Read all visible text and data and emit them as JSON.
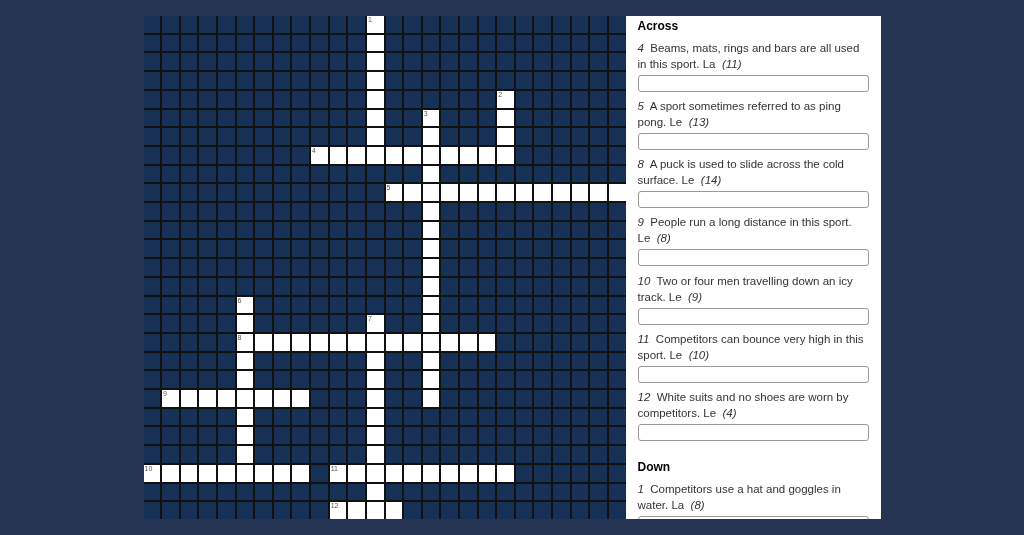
{
  "grid": {
    "rows": [
      [
        {
          "open": false
        },
        {
          "open": false
        },
        {
          "open": false
        },
        {
          "open": false
        },
        {
          "open": false
        },
        {
          "open": false
        },
        {
          "open": false
        },
        {
          "open": false
        },
        {
          "open": false
        },
        {
          "open": false
        },
        {
          "open": false
        },
        {
          "open": false
        },
        {
          "open": true,
          "number": "1"
        },
        {
          "open": false
        },
        {
          "open": false
        },
        {
          "open": false
        },
        {
          "open": false
        },
        {
          "open": false
        },
        {
          "open": false
        },
        {
          "open": false
        },
        {
          "open": false
        },
        {
          "open": false
        },
        {
          "open": false
        },
        {
          "open": false
        },
        {
          "open": false
        },
        {
          "open": false
        }
      ],
      [
        {
          "open": false
        },
        {
          "open": false
        },
        {
          "open": false
        },
        {
          "open": false
        },
        {
          "open": false
        },
        {
          "open": false
        },
        {
          "open": false
        },
        {
          "open": false
        },
        {
          "open": false
        },
        {
          "open": false
        },
        {
          "open": false
        },
        {
          "open": false
        },
        {
          "open": true
        },
        {
          "open": false
        },
        {
          "open": false
        },
        {
          "open": false
        },
        {
          "open": false
        },
        {
          "open": false
        },
        {
          "open": false
        },
        {
          "open": false
        },
        {
          "open": false
        },
        {
          "open": false
        },
        {
          "open": false
        },
        {
          "open": false
        },
        {
          "open": false
        },
        {
          "open": false
        }
      ],
      [
        {
          "open": false
        },
        {
          "open": false
        },
        {
          "open": false
        },
        {
          "open": false
        },
        {
          "open": false
        },
        {
          "open": false
        },
        {
          "open": false
        },
        {
          "open": false
        },
        {
          "open": false
        },
        {
          "open": false
        },
        {
          "open": false
        },
        {
          "open": false
        },
        {
          "open": true
        },
        {
          "open": false
        },
        {
          "open": false
        },
        {
          "open": false
        },
        {
          "open": false
        },
        {
          "open": false
        },
        {
          "open": false
        },
        {
          "open": false
        },
        {
          "open": false
        },
        {
          "open": false
        },
        {
          "open": false
        },
        {
          "open": false
        },
        {
          "open": false
        },
        {
          "open": false
        }
      ],
      [
        {
          "open": false
        },
        {
          "open": false
        },
        {
          "open": false
        },
        {
          "open": false
        },
        {
          "open": false
        },
        {
          "open": false
        },
        {
          "open": false
        },
        {
          "open": false
        },
        {
          "open": false
        },
        {
          "open": false
        },
        {
          "open": false
        },
        {
          "open": false
        },
        {
          "open": true
        },
        {
          "open": false
        },
        {
          "open": false
        },
        {
          "open": false
        },
        {
          "open": false
        },
        {
          "open": false
        },
        {
          "open": false
        },
        {
          "open": false
        },
        {
          "open": false
        },
        {
          "open": false
        },
        {
          "open": false
        },
        {
          "open": false
        },
        {
          "open": false
        },
        {
          "open": false
        }
      ],
      [
        {
          "open": false
        },
        {
          "open": false
        },
        {
          "open": false
        },
        {
          "open": false
        },
        {
          "open": false
        },
        {
          "open": false
        },
        {
          "open": false
        },
        {
          "open": false
        },
        {
          "open": false
        },
        {
          "open": false
        },
        {
          "open": false
        },
        {
          "open": false
        },
        {
          "open": true
        },
        {
          "open": false
        },
        {
          "open": false
        },
        {
          "open": false
        },
        {
          "open": false
        },
        {
          "open": false
        },
        {
          "open": false
        },
        {
          "open": true,
          "number": "2"
        },
        {
          "open": false
        },
        {
          "open": false
        },
        {
          "open": false
        },
        {
          "open": false
        },
        {
          "open": false
        },
        {
          "open": false
        }
      ],
      [
        {
          "open": false
        },
        {
          "open": false
        },
        {
          "open": false
        },
        {
          "open": false
        },
        {
          "open": false
        },
        {
          "open": false
        },
        {
          "open": false
        },
        {
          "open": false
        },
        {
          "open": false
        },
        {
          "open": false
        },
        {
          "open": false
        },
        {
          "open": false
        },
        {
          "open": true
        },
        {
          "open": false
        },
        {
          "open": false
        },
        {
          "open": true,
          "number": "3"
        },
        {
          "open": false
        },
        {
          "open": false
        },
        {
          "open": false
        },
        {
          "open": true
        },
        {
          "open": false
        },
        {
          "open": false
        },
        {
          "open": false
        },
        {
          "open": false
        },
        {
          "open": false
        },
        {
          "open": false
        }
      ],
      [
        {
          "open": false
        },
        {
          "open": false
        },
        {
          "open": false
        },
        {
          "open": false
        },
        {
          "open": false
        },
        {
          "open": false
        },
        {
          "open": false
        },
        {
          "open": false
        },
        {
          "open": false
        },
        {
          "open": false
        },
        {
          "open": false
        },
        {
          "open": false
        },
        {
          "open": true
        },
        {
          "open": false
        },
        {
          "open": false
        },
        {
          "open": true
        },
        {
          "open": false
        },
        {
          "open": false
        },
        {
          "open": false
        },
        {
          "open": true
        },
        {
          "open": false
        },
        {
          "open": false
        },
        {
          "open": false
        },
        {
          "open": false
        },
        {
          "open": false
        },
        {
          "open": false
        }
      ],
      [
        {
          "open": false
        },
        {
          "open": false
        },
        {
          "open": false
        },
        {
          "open": false
        },
        {
          "open": false
        },
        {
          "open": false
        },
        {
          "open": false
        },
        {
          "open": false
        },
        {
          "open": false
        },
        {
          "open": true,
          "number": "4"
        },
        {
          "open": true
        },
        {
          "open": true
        },
        {
          "open": true
        },
        {
          "open": true
        },
        {
          "open": true
        },
        {
          "open": true
        },
        {
          "open": true
        },
        {
          "open": true
        },
        {
          "open": true
        },
        {
          "open": true
        },
        {
          "open": false
        },
        {
          "open": false
        },
        {
          "open": false
        },
        {
          "open": false
        },
        {
          "open": false
        },
        {
          "open": false
        }
      ],
      [
        {
          "open": false
        },
        {
          "open": false
        },
        {
          "open": false
        },
        {
          "open": false
        },
        {
          "open": false
        },
        {
          "open": false
        },
        {
          "open": false
        },
        {
          "open": false
        },
        {
          "open": false
        },
        {
          "open": false
        },
        {
          "open": false
        },
        {
          "open": false
        },
        {
          "open": false
        },
        {
          "open": false
        },
        {
          "open": false
        },
        {
          "open": true
        },
        {
          "open": false
        },
        {
          "open": false
        },
        {
          "open": false
        },
        {
          "open": false
        },
        {
          "open": false
        },
        {
          "open": false
        },
        {
          "open": false
        },
        {
          "open": false
        },
        {
          "open": false
        },
        {
          "open": false
        }
      ],
      [
        {
          "open": false
        },
        {
          "open": false
        },
        {
          "open": false
        },
        {
          "open": false
        },
        {
          "open": false
        },
        {
          "open": false
        },
        {
          "open": false
        },
        {
          "open": false
        },
        {
          "open": false
        },
        {
          "open": false
        },
        {
          "open": false
        },
        {
          "open": false
        },
        {
          "open": false
        },
        {
          "open": true,
          "number": "5"
        },
        {
          "open": true
        },
        {
          "open": true
        },
        {
          "open": true
        },
        {
          "open": true
        },
        {
          "open": true
        },
        {
          "open": true
        },
        {
          "open": true
        },
        {
          "open": true
        },
        {
          "open": true
        },
        {
          "open": true
        },
        {
          "open": true
        },
        {
          "open": true
        }
      ],
      [
        {
          "open": false
        },
        {
          "open": false
        },
        {
          "open": false
        },
        {
          "open": false
        },
        {
          "open": false
        },
        {
          "open": false
        },
        {
          "open": false
        },
        {
          "open": false
        },
        {
          "open": false
        },
        {
          "open": false
        },
        {
          "open": false
        },
        {
          "open": false
        },
        {
          "open": false
        },
        {
          "open": false
        },
        {
          "open": false
        },
        {
          "open": true
        },
        {
          "open": false
        },
        {
          "open": false
        },
        {
          "open": false
        },
        {
          "open": false
        },
        {
          "open": false
        },
        {
          "open": false
        },
        {
          "open": false
        },
        {
          "open": false
        },
        {
          "open": false
        },
        {
          "open": false
        }
      ],
      [
        {
          "open": false
        },
        {
          "open": false
        },
        {
          "open": false
        },
        {
          "open": false
        },
        {
          "open": false
        },
        {
          "open": false
        },
        {
          "open": false
        },
        {
          "open": false
        },
        {
          "open": false
        },
        {
          "open": false
        },
        {
          "open": false
        },
        {
          "open": false
        },
        {
          "open": false
        },
        {
          "open": false
        },
        {
          "open": false
        },
        {
          "open": true
        },
        {
          "open": false
        },
        {
          "open": false
        },
        {
          "open": false
        },
        {
          "open": false
        },
        {
          "open": false
        },
        {
          "open": false
        },
        {
          "open": false
        },
        {
          "open": false
        },
        {
          "open": false
        },
        {
          "open": false
        }
      ],
      [
        {
          "open": false
        },
        {
          "open": false
        },
        {
          "open": false
        },
        {
          "open": false
        },
        {
          "open": false
        },
        {
          "open": false
        },
        {
          "open": false
        },
        {
          "open": false
        },
        {
          "open": false
        },
        {
          "open": false
        },
        {
          "open": false
        },
        {
          "open": false
        },
        {
          "open": false
        },
        {
          "open": false
        },
        {
          "open": false
        },
        {
          "open": true
        },
        {
          "open": false
        },
        {
          "open": false
        },
        {
          "open": false
        },
        {
          "open": false
        },
        {
          "open": false
        },
        {
          "open": false
        },
        {
          "open": false
        },
        {
          "open": false
        },
        {
          "open": false
        },
        {
          "open": false
        }
      ],
      [
        {
          "open": false
        },
        {
          "open": false
        },
        {
          "open": false
        },
        {
          "open": false
        },
        {
          "open": false
        },
        {
          "open": false
        },
        {
          "open": false
        },
        {
          "open": false
        },
        {
          "open": false
        },
        {
          "open": false
        },
        {
          "open": false
        },
        {
          "open": false
        },
        {
          "open": false
        },
        {
          "open": false
        },
        {
          "open": false
        },
        {
          "open": true
        },
        {
          "open": false
        },
        {
          "open": false
        },
        {
          "open": false
        },
        {
          "open": false
        },
        {
          "open": false
        },
        {
          "open": false
        },
        {
          "open": false
        },
        {
          "open": false
        },
        {
          "open": false
        },
        {
          "open": false
        }
      ],
      [
        {
          "open": false
        },
        {
          "open": false
        },
        {
          "open": false
        },
        {
          "open": false
        },
        {
          "open": false
        },
        {
          "open": false
        },
        {
          "open": false
        },
        {
          "open": false
        },
        {
          "open": false
        },
        {
          "open": false
        },
        {
          "open": false
        },
        {
          "open": false
        },
        {
          "open": false
        },
        {
          "open": false
        },
        {
          "open": false
        },
        {
          "open": true
        },
        {
          "open": false
        },
        {
          "open": false
        },
        {
          "open": false
        },
        {
          "open": false
        },
        {
          "open": false
        },
        {
          "open": false
        },
        {
          "open": false
        },
        {
          "open": false
        },
        {
          "open": false
        },
        {
          "open": false
        }
      ],
      [
        {
          "open": false
        },
        {
          "open": false
        },
        {
          "open": false
        },
        {
          "open": false
        },
        {
          "open": false
        },
        {
          "open": true,
          "number": "6"
        },
        {
          "open": false
        },
        {
          "open": false
        },
        {
          "open": false
        },
        {
          "open": false
        },
        {
          "open": false
        },
        {
          "open": false
        },
        {
          "open": false
        },
        {
          "open": false
        },
        {
          "open": false
        },
        {
          "open": true
        },
        {
          "open": false
        },
        {
          "open": false
        },
        {
          "open": false
        },
        {
          "open": false
        },
        {
          "open": false
        },
        {
          "open": false
        },
        {
          "open": false
        },
        {
          "open": false
        },
        {
          "open": false
        },
        {
          "open": false
        }
      ],
      [
        {
          "open": false
        },
        {
          "open": false
        },
        {
          "open": false
        },
        {
          "open": false
        },
        {
          "open": false
        },
        {
          "open": true
        },
        {
          "open": false
        },
        {
          "open": false
        },
        {
          "open": false
        },
        {
          "open": false
        },
        {
          "open": false
        },
        {
          "open": false
        },
        {
          "open": true,
          "number": "7"
        },
        {
          "open": false
        },
        {
          "open": false
        },
        {
          "open": true
        },
        {
          "open": false
        },
        {
          "open": false
        },
        {
          "open": false
        },
        {
          "open": false
        },
        {
          "open": false
        },
        {
          "open": false
        },
        {
          "open": false
        },
        {
          "open": false
        },
        {
          "open": false
        },
        {
          "open": false
        }
      ],
      [
        {
          "open": false
        },
        {
          "open": false
        },
        {
          "open": false
        },
        {
          "open": false
        },
        {
          "open": false
        },
        {
          "open": true,
          "number": "8"
        },
        {
          "open": true
        },
        {
          "open": true
        },
        {
          "open": true
        },
        {
          "open": true
        },
        {
          "open": true
        },
        {
          "open": true
        },
        {
          "open": true
        },
        {
          "open": true
        },
        {
          "open": true
        },
        {
          "open": true
        },
        {
          "open": true
        },
        {
          "open": true
        },
        {
          "open": true
        },
        {
          "open": false
        },
        {
          "open": false
        },
        {
          "open": false
        },
        {
          "open": false
        },
        {
          "open": false
        },
        {
          "open": false
        },
        {
          "open": false
        }
      ],
      [
        {
          "open": false
        },
        {
          "open": false
        },
        {
          "open": false
        },
        {
          "open": false
        },
        {
          "open": false
        },
        {
          "open": true
        },
        {
          "open": false
        },
        {
          "open": false
        },
        {
          "open": false
        },
        {
          "open": false
        },
        {
          "open": false
        },
        {
          "open": false
        },
        {
          "open": true
        },
        {
          "open": false
        },
        {
          "open": false
        },
        {
          "open": true
        },
        {
          "open": false
        },
        {
          "open": false
        },
        {
          "open": false
        },
        {
          "open": false
        },
        {
          "open": false
        },
        {
          "open": false
        },
        {
          "open": false
        },
        {
          "open": false
        },
        {
          "open": false
        },
        {
          "open": false
        }
      ],
      [
        {
          "open": false
        },
        {
          "open": false
        },
        {
          "open": false
        },
        {
          "open": false
        },
        {
          "open": false
        },
        {
          "open": true
        },
        {
          "open": false
        },
        {
          "open": false
        },
        {
          "open": false
        },
        {
          "open": false
        },
        {
          "open": false
        },
        {
          "open": false
        },
        {
          "open": true
        },
        {
          "open": false
        },
        {
          "open": false
        },
        {
          "open": true
        },
        {
          "open": false
        },
        {
          "open": false
        },
        {
          "open": false
        },
        {
          "open": false
        },
        {
          "open": false
        },
        {
          "open": false
        },
        {
          "open": false
        },
        {
          "open": false
        },
        {
          "open": false
        },
        {
          "open": false
        }
      ],
      [
        {
          "open": false
        },
        {
          "open": true,
          "number": "9"
        },
        {
          "open": true
        },
        {
          "open": true
        },
        {
          "open": true
        },
        {
          "open": true
        },
        {
          "open": true
        },
        {
          "open": true
        },
        {
          "open": true
        },
        {
          "open": false
        },
        {
          "open": false
        },
        {
          "open": false
        },
        {
          "open": true
        },
        {
          "open": false
        },
        {
          "open": false
        },
        {
          "open": true
        },
        {
          "open": false
        },
        {
          "open": false
        },
        {
          "open": false
        },
        {
          "open": false
        },
        {
          "open": false
        },
        {
          "open": false
        },
        {
          "open": false
        },
        {
          "open": false
        },
        {
          "open": false
        },
        {
          "open": false
        }
      ],
      [
        {
          "open": false
        },
        {
          "open": false
        },
        {
          "open": false
        },
        {
          "open": false
        },
        {
          "open": false
        },
        {
          "open": true
        },
        {
          "open": false
        },
        {
          "open": false
        },
        {
          "open": false
        },
        {
          "open": false
        },
        {
          "open": false
        },
        {
          "open": false
        },
        {
          "open": true
        },
        {
          "open": false
        },
        {
          "open": false
        },
        {
          "open": false
        },
        {
          "open": false
        },
        {
          "open": false
        },
        {
          "open": false
        },
        {
          "open": false
        },
        {
          "open": false
        },
        {
          "open": false
        },
        {
          "open": false
        },
        {
          "open": false
        },
        {
          "open": false
        },
        {
          "open": false
        }
      ],
      [
        {
          "open": false
        },
        {
          "open": false
        },
        {
          "open": false
        },
        {
          "open": false
        },
        {
          "open": false
        },
        {
          "open": true
        },
        {
          "open": false
        },
        {
          "open": false
        },
        {
          "open": false
        },
        {
          "open": false
        },
        {
          "open": false
        },
        {
          "open": false
        },
        {
          "open": true
        },
        {
          "open": false
        },
        {
          "open": false
        },
        {
          "open": false
        },
        {
          "open": false
        },
        {
          "open": false
        },
        {
          "open": false
        },
        {
          "open": false
        },
        {
          "open": false
        },
        {
          "open": false
        },
        {
          "open": false
        },
        {
          "open": false
        },
        {
          "open": false
        },
        {
          "open": false
        }
      ],
      [
        {
          "open": false
        },
        {
          "open": false
        },
        {
          "open": false
        },
        {
          "open": false
        },
        {
          "open": false
        },
        {
          "open": true
        },
        {
          "open": false
        },
        {
          "open": false
        },
        {
          "open": false
        },
        {
          "open": false
        },
        {
          "open": false
        },
        {
          "open": false
        },
        {
          "open": true
        },
        {
          "open": false
        },
        {
          "open": false
        },
        {
          "open": false
        },
        {
          "open": false
        },
        {
          "open": false
        },
        {
          "open": false
        },
        {
          "open": false
        },
        {
          "open": false
        },
        {
          "open": false
        },
        {
          "open": false
        },
        {
          "open": false
        },
        {
          "open": false
        },
        {
          "open": false
        }
      ],
      [
        {
          "open": true,
          "number": "10"
        },
        {
          "open": true
        },
        {
          "open": true
        },
        {
          "open": true
        },
        {
          "open": true
        },
        {
          "open": true
        },
        {
          "open": true
        },
        {
          "open": true
        },
        {
          "open": true
        },
        {
          "open": false
        },
        {
          "open": true,
          "number": "11"
        },
        {
          "open": true
        },
        {
          "open": true
        },
        {
          "open": true
        },
        {
          "open": true
        },
        {
          "open": true
        },
        {
          "open": true
        },
        {
          "open": true
        },
        {
          "open": true
        },
        {
          "open": true
        },
        {
          "open": false
        },
        {
          "open": false
        },
        {
          "open": false
        },
        {
          "open": false
        },
        {
          "open": false
        },
        {
          "open": false
        }
      ],
      [
        {
          "open": false
        },
        {
          "open": false
        },
        {
          "open": false
        },
        {
          "open": false
        },
        {
          "open": false
        },
        {
          "open": false
        },
        {
          "open": false
        },
        {
          "open": false
        },
        {
          "open": false
        },
        {
          "open": false
        },
        {
          "open": false
        },
        {
          "open": false
        },
        {
          "open": true
        },
        {
          "open": false
        },
        {
          "open": false
        },
        {
          "open": false
        },
        {
          "open": false
        },
        {
          "open": false
        },
        {
          "open": false
        },
        {
          "open": false
        },
        {
          "open": false
        },
        {
          "open": false
        },
        {
          "open": false
        },
        {
          "open": false
        },
        {
          "open": false
        },
        {
          "open": false
        }
      ],
      [
        {
          "open": false
        },
        {
          "open": false
        },
        {
          "open": false
        },
        {
          "open": false
        },
        {
          "open": false
        },
        {
          "open": false
        },
        {
          "open": false
        },
        {
          "open": false
        },
        {
          "open": false
        },
        {
          "open": false
        },
        {
          "open": true,
          "number": "12"
        },
        {
          "open": true
        },
        {
          "open": true
        },
        {
          "open": true
        },
        {
          "open": false
        },
        {
          "open": false
        },
        {
          "open": false
        },
        {
          "open": false
        },
        {
          "open": false
        },
        {
          "open": false
        },
        {
          "open": false
        },
        {
          "open": false
        },
        {
          "open": false
        },
        {
          "open": false
        },
        {
          "open": false
        },
        {
          "open": false
        }
      ]
    ]
  },
  "clue_sections": [
    {
      "heading": "Across",
      "clues": [
        {
          "number": "4",
          "text": "Beams, mats, rings and bars are all used in this sport. La",
          "length": "(11)"
        },
        {
          "number": "5",
          "text": "A sport sometimes referred to as ping pong. Le",
          "length": "(13)"
        },
        {
          "number": "8",
          "text": "A puck is used to slide across the cold surface. Le",
          "length": "(14)"
        },
        {
          "number": "9",
          "text": "People run a long distance in this sport. Le",
          "length": "(8)"
        },
        {
          "number": "10",
          "text": "Two or four men travelling down an icy track. Le",
          "length": "(9)"
        },
        {
          "number": "11",
          "text": "Competitors can bounce very high in this sport. Le",
          "length": "(10)"
        },
        {
          "number": "12",
          "text": "White suits and no shoes are worn by competitors. Le",
          "length": "(4)"
        }
      ]
    },
    {
      "heading": "Down",
      "clues": [
        {
          "number": "1",
          "text": "Competitors use a hat and goggles in water. La",
          "length": "(8)"
        }
      ]
    }
  ]
}
